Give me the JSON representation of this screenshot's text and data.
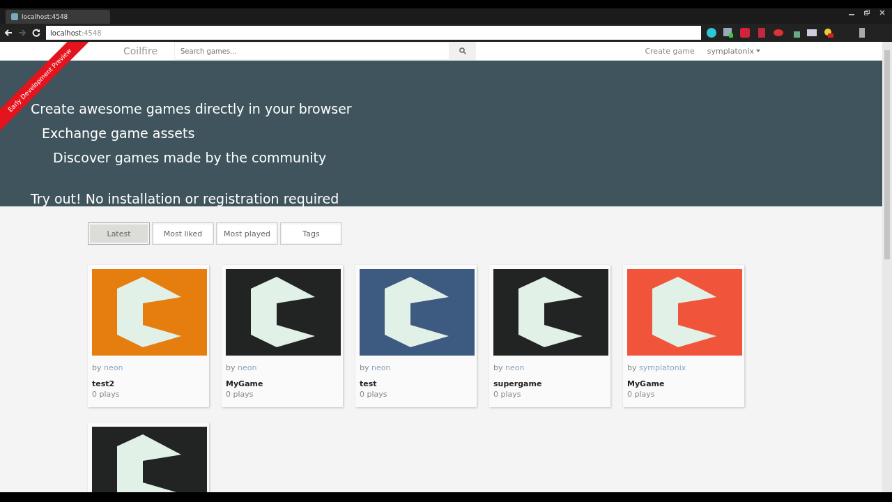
{
  "browser": {
    "tab_title": "localhost:4548",
    "url_host": "localhost",
    "url_port": ":4548"
  },
  "ribbon": "Early Development Preview",
  "navbar": {
    "brand": "Coilfire",
    "search": {
      "placeholder": "Search games..."
    },
    "links": [
      "Create game"
    ],
    "user": "symplatonix"
  },
  "hero": {
    "lines": [
      "Create awesome games directly in your browser",
      "Exchange game assets",
      "Discover games made by the community"
    ],
    "cta": "Try out! No installation or registration required"
  },
  "tabs": [
    {
      "label": "Latest",
      "selected": true
    },
    {
      "label": "Most liked",
      "selected": false
    },
    {
      "label": "Most played",
      "selected": false
    },
    {
      "label": "Tags",
      "selected": false
    }
  ],
  "games": [
    {
      "color": "#e67e0f",
      "by": "by",
      "author": "neon",
      "title": "test2",
      "plays": "0 plays"
    },
    {
      "color": "#222423",
      "by": "by",
      "author": "neon",
      "title": "MyGame",
      "plays": "0 plays"
    },
    {
      "color": "#3d5a80",
      "by": "by",
      "author": "neon",
      "title": "test",
      "plays": "0 plays"
    },
    {
      "color": "#222423",
      "by": "by",
      "author": "neon",
      "title": "supergame",
      "plays": "0 plays"
    },
    {
      "color": "#f0553b",
      "by": "by",
      "author": "symplatonix",
      "title": "MyGame",
      "plays": "0 plays"
    },
    {
      "color": "#222423"
    }
  ]
}
